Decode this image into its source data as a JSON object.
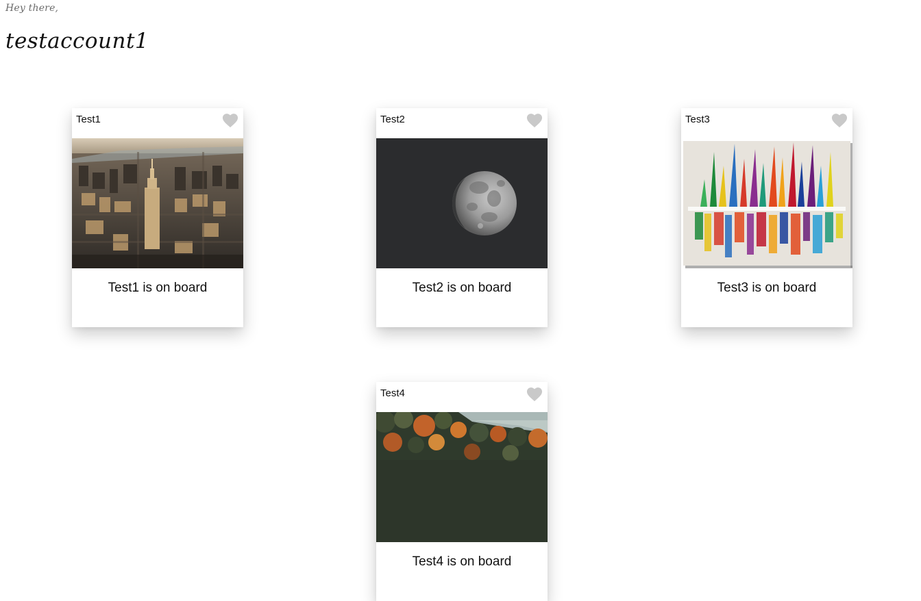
{
  "header": {
    "greeting": "Hey there,",
    "username": "testaccount1"
  },
  "colors": {
    "heart": "#c9c9c9",
    "card_shadow": "rgba(0,0,0,0.2)",
    "moon_background": "#2b2c2e"
  },
  "cards": [
    {
      "title": "Test1",
      "caption": "Test1 is on board",
      "image": "aerial city skyline photo",
      "liked": false
    },
    {
      "title": "Test2",
      "caption": "Test2 is on board",
      "image": "moon photo",
      "liked": false
    },
    {
      "title": "Test3",
      "caption": "Test3 is on board",
      "image": "colorful sailboats painting",
      "liked": false
    },
    {
      "title": "Test4",
      "caption": "Test4 is on board",
      "image": "autumn forest with waterfall photo",
      "liked": false
    }
  ]
}
